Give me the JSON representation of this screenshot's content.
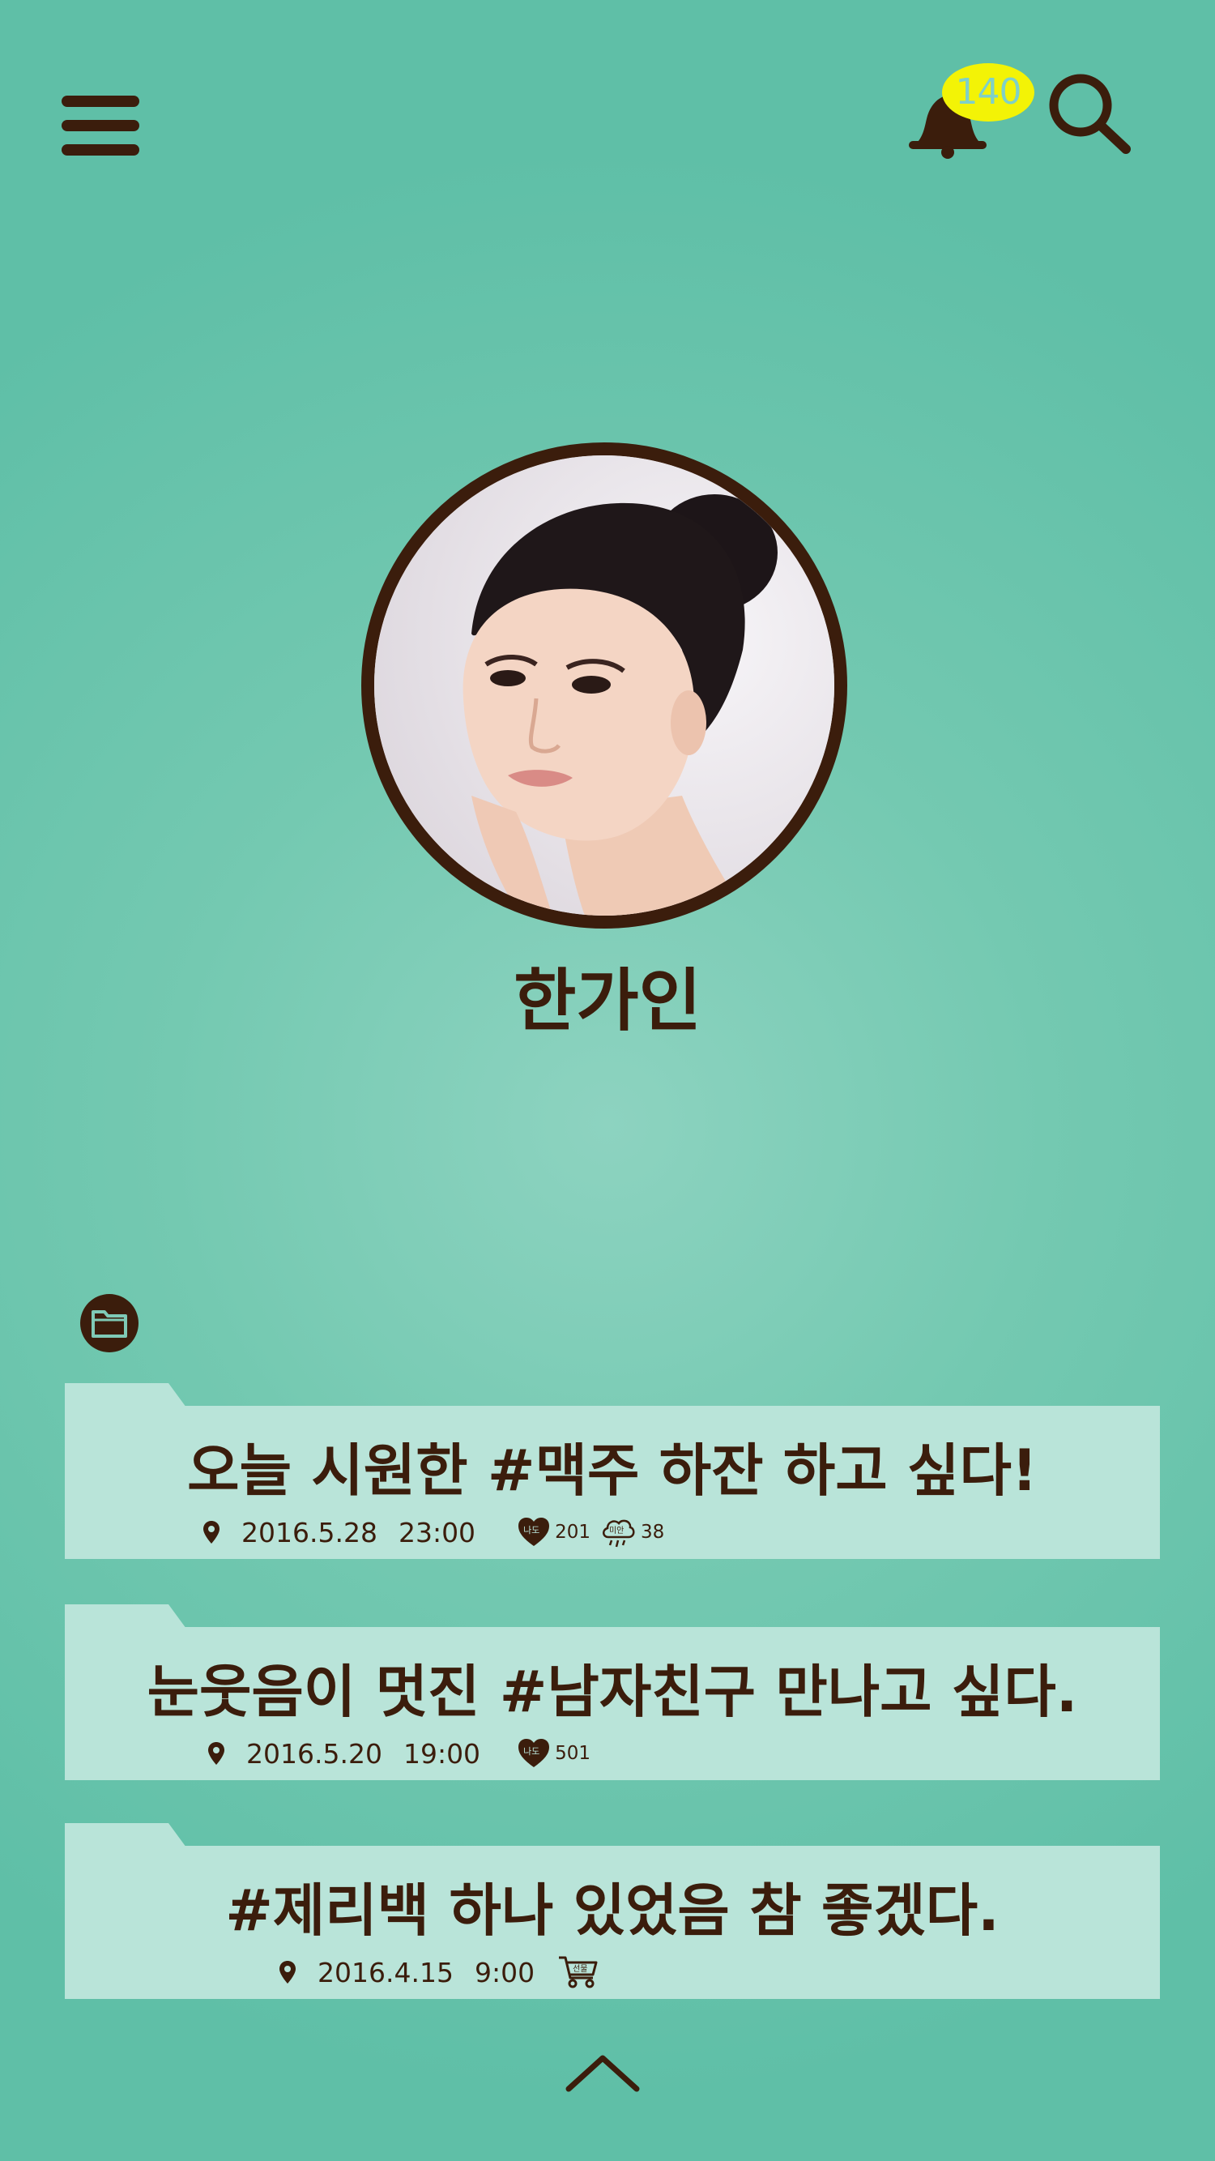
{
  "header": {
    "menu_icon": "hamburger-menu-icon",
    "bell_icon": "bell-icon",
    "notification_count": "140",
    "search_icon": "search-icon",
    "accent_color": "#f3f306",
    "text_color": "#3b1d0c",
    "background_color": "#6cc6ae"
  },
  "profile": {
    "name": "한가인",
    "avatar": "profile-photo"
  },
  "section": {
    "icon": "folder-icon"
  },
  "posts": [
    {
      "title": "오늘 시원한 #맥주 하잔 하고 싶다!",
      "date": "2016.5.28",
      "time": "23:00",
      "metoo_badge": "나도",
      "metoo_count": "201",
      "sorry_badge": "미안",
      "sorry_count": "38"
    },
    {
      "title": "눈웃음이 멋진 #남자친구 만나고 싶다.",
      "date": "2016.5.20",
      "time": "19:00",
      "metoo_badge": "나도",
      "metoo_count": "501"
    },
    {
      "title": "#제리백 하나 있었음 참 좋겠다.",
      "date": "2016.4.15",
      "time": "9:00",
      "gift_badge": "선물"
    }
  ],
  "footer": {
    "scroll_up_icon": "chevron-up-icon"
  }
}
